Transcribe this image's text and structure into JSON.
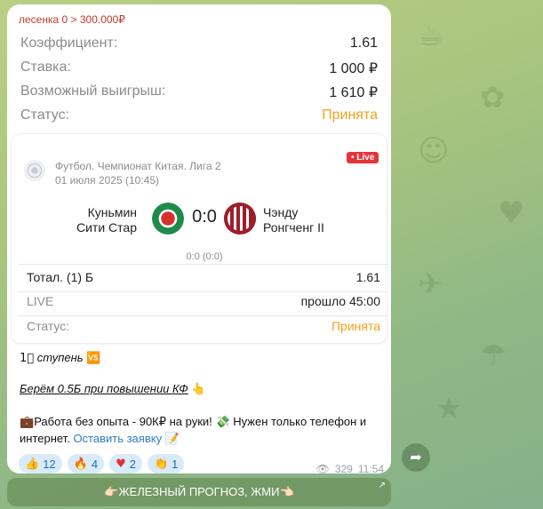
{
  "message": {
    "header": "лесенка 0 > 300.000₽",
    "summary": [
      {
        "label": "Коэффициент:",
        "value": "1.61"
      },
      {
        "label": "Ставка:",
        "value": "1 000 ₽"
      },
      {
        "label": "Возможный выигрыш:",
        "value": "1 610 ₽"
      },
      {
        "label": "Статус:",
        "value": "Принята"
      }
    ],
    "card": {
      "league": "Футбол. Чемпионат Китая. Лига 2",
      "datetime": "01 июля 2025 (10:45)",
      "live_badge": "• Live",
      "team_home_line1": "Куньмин",
      "team_home_line2": "Сити Стар",
      "team_away_line1": "Чэнду",
      "team_away_line2": "Ронгченг II",
      "score": "0:0",
      "sub_score": "0:0 (0:0)",
      "rows": [
        {
          "label": "Тотал. (1) Б",
          "value": "1.61"
        },
        {
          "label": "LIVE",
          "value": "прошло 45:00"
        },
        {
          "label": "Статус:",
          "value": "Принята"
        }
      ]
    },
    "step_text": "ступень",
    "take_text": "Берём 0.5Б при повышении КФ",
    "promo_text_1": "Работа без опыта - 90К₽ на руки!",
    "promo_text_2": "Нужен только телефон и",
    "promo_text_3": "интернет.",
    "promo_link": "Оставить заявку",
    "reactions": [
      {
        "emoji": "thumbs-up",
        "count": "12"
      },
      {
        "emoji": "fire",
        "count": "4"
      },
      {
        "emoji": "heart",
        "count": "2"
      },
      {
        "emoji": "clap",
        "count": "1"
      }
    ],
    "views": "329",
    "time": "11:54"
  },
  "cta_button": "👉🏻ЖЕЛЕЗНЫЙ ПРОГНОЗ, ЖМИ👈🏻",
  "colors": {
    "status": "#f0a21a",
    "header_red": "#c0392b",
    "link": "#2f7ec1",
    "live": "#e5343a"
  }
}
